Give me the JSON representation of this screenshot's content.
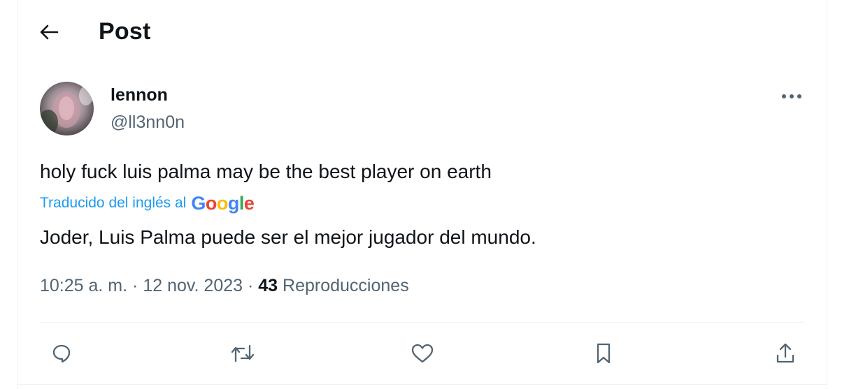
{
  "header": {
    "title": "Post",
    "back_icon": "arrow-left-icon"
  },
  "author": {
    "name": "lennon",
    "handle": "@ll3nn0n",
    "avatar": "avatar-image"
  },
  "post": {
    "text": "holy fuck luis palma may be the best player on earth",
    "translation_label": "Traducido del inglés al",
    "translation_provider": "Google",
    "translated_text": "Joder, Luis Palma puede ser el mejor jugador del mundo."
  },
  "meta": {
    "time": "10:25 a. m.",
    "separator": "·",
    "date": "12 nov. 2023",
    "views_count": "43",
    "views_label": "Reproducciones"
  },
  "actions": {
    "reply_icon": "reply-icon",
    "repost_icon": "repost-icon",
    "like_icon": "heart-icon",
    "bookmark_icon": "bookmark-icon",
    "share_icon": "share-icon",
    "more_icon": "more-horizontal-icon"
  },
  "colors": {
    "text_primary": "#0f1419",
    "text_secondary": "#536471",
    "link_blue": "#1d9bf0",
    "border": "#eff3f4",
    "google_blue": "#4285f4",
    "google_red": "#ea4335",
    "google_yellow": "#fbbc05",
    "google_green": "#34a853"
  }
}
